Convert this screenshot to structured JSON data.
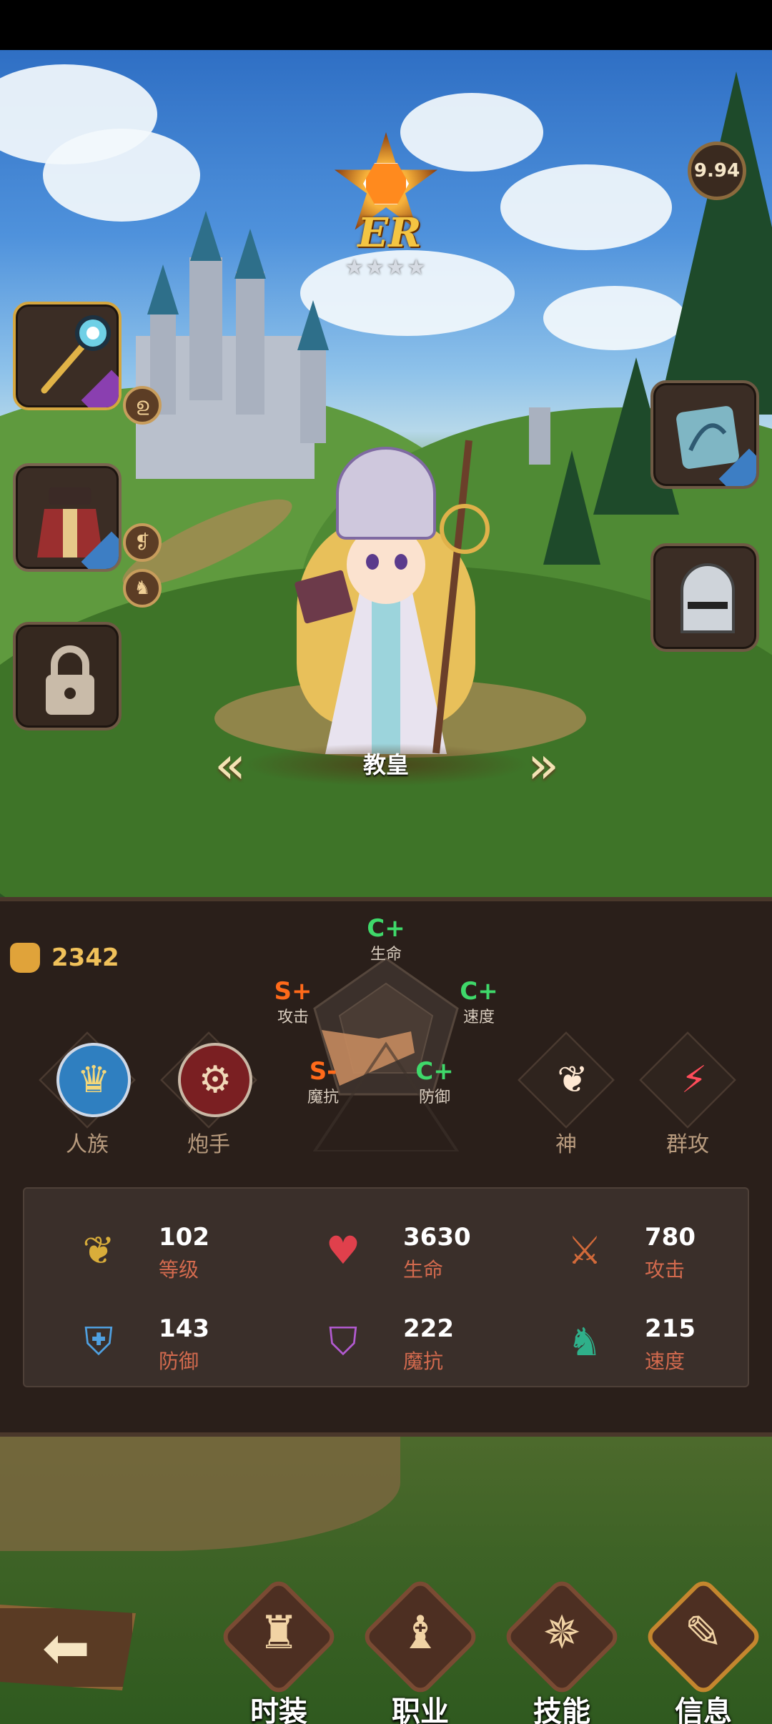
{
  "hero": {
    "rank": "ER",
    "rank_stars": "★★★★",
    "score": "9.94",
    "name": "教皇",
    "armor_stars": "★★★",
    "power": "2342"
  },
  "grades": {
    "hp": {
      "grade": "C+",
      "label": "生命",
      "color": "#3fd86a"
    },
    "atk": {
      "grade": "S+",
      "label": "攻击",
      "color": "#ff6a1a"
    },
    "spd": {
      "grade": "C+",
      "label": "速度",
      "color": "#3fd86a"
    },
    "mres": {
      "grade": "S-",
      "label": "魔抗",
      "color": "#ff6a1a"
    },
    "def": {
      "grade": "C+",
      "label": "防御",
      "color": "#3fd86a"
    }
  },
  "traits": [
    {
      "label": "人族",
      "icon": "crown-icon"
    },
    {
      "label": "炮手",
      "icon": "cannon-icon"
    },
    {
      "label": "神",
      "icon": "wings-icon"
    },
    {
      "label": "群攻",
      "icon": "claw-icon"
    }
  ],
  "stats": [
    {
      "value": "102",
      "label": "等级",
      "icon": "laurel-icon"
    },
    {
      "value": "3630",
      "label": "生命",
      "icon": "heart-icon"
    },
    {
      "value": "780",
      "label": "攻击",
      "icon": "sword-icon"
    },
    {
      "value": "143",
      "label": "防御",
      "icon": "shield-icon"
    },
    {
      "value": "222",
      "label": "魔抗",
      "icon": "magic-shield-icon"
    },
    {
      "value": "215",
      "label": "速度",
      "icon": "boot-icon"
    }
  ],
  "nav": [
    {
      "label": "时装",
      "icon": "costume-icon"
    },
    {
      "label": "职业",
      "icon": "chess-icon"
    },
    {
      "label": "技能",
      "icon": "skill-icon"
    },
    {
      "label": "信息",
      "icon": "scroll-icon"
    }
  ],
  "colors": {
    "accent_gold": "#f0c15a",
    "grade_high": "#ff6a1a",
    "grade_mid": "#3fd86a",
    "stat_label": "#d36a4e"
  }
}
